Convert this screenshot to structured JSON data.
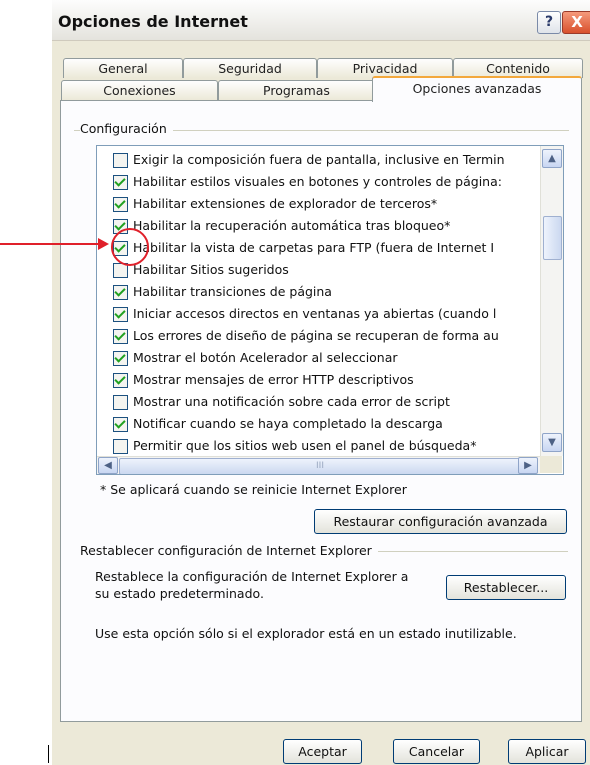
{
  "window": {
    "title": "Opciones de Internet",
    "help_glyph": "?",
    "close_glyph": "X"
  },
  "tabs": {
    "row1": [
      "General",
      "Seguridad",
      "Privacidad",
      "Contenido"
    ],
    "row2": [
      "Conexiones",
      "Programas",
      "Opciones avanzadas"
    ],
    "active": "Opciones avanzadas"
  },
  "settings": {
    "group_label": "Configuración",
    "items": [
      {
        "label": "Exigir la composición fuera de pantalla, inclusive en Termin",
        "checked": false
      },
      {
        "label": "Habilitar estilos visuales en botones y controles de página:",
        "checked": true
      },
      {
        "label": "Habilitar extensiones de explorador de terceros*",
        "checked": true
      },
      {
        "label": "Habilitar la recuperación automática tras bloqueo*",
        "checked": true
      },
      {
        "label": "Habilitar la vista de carpetas para FTP (fuera de Internet I",
        "checked": true
      },
      {
        "label": "Habilitar Sitios sugeridos",
        "checked": false
      },
      {
        "label": "Habilitar transiciones de página",
        "checked": true
      },
      {
        "label": "Iniciar accesos directos en ventanas ya abiertas (cuando l",
        "checked": true
      },
      {
        "label": "Los errores de diseño de página se recuperan de forma au",
        "checked": true
      },
      {
        "label": "Mostrar el botón Acelerador al seleccionar",
        "checked": true
      },
      {
        "label": "Mostrar mensajes de error HTTP descriptivos",
        "checked": true
      },
      {
        "label": "Mostrar una notificación sobre cada error de script",
        "checked": false
      },
      {
        "label": "Notificar cuando se haya completado la descarga",
        "checked": true
      },
      {
        "label": "Permitir que los sitios web usen el panel de búsqueda*",
        "checked": false
      }
    ],
    "scroll_up": "▲",
    "scroll_down": "▼",
    "scroll_left": "◀",
    "scroll_right": "▶",
    "hthumb_grip": "III",
    "restart_note": "* Se aplicará cuando se reinicie Internet Explorer",
    "restore_button": "Restaurar configuración avanzada"
  },
  "reset": {
    "group_label": "Restablecer configuración de Internet Explorer",
    "desc_line1": "Restablece la configuración de Internet Explorer a",
    "desc_line2": "su estado predeterminado.",
    "button": "Restablecer...",
    "note": "Use esta opción sólo si el explorador está en un estado inutilizable."
  },
  "footer": {
    "ok": "Aceptar",
    "cancel": "Cancelar",
    "apply": "Aplicar"
  },
  "annotation": {
    "color": "#e0202a",
    "highlighted_item": "Habilitar la vista de carpetas para FTP (fuera de Internet I"
  }
}
